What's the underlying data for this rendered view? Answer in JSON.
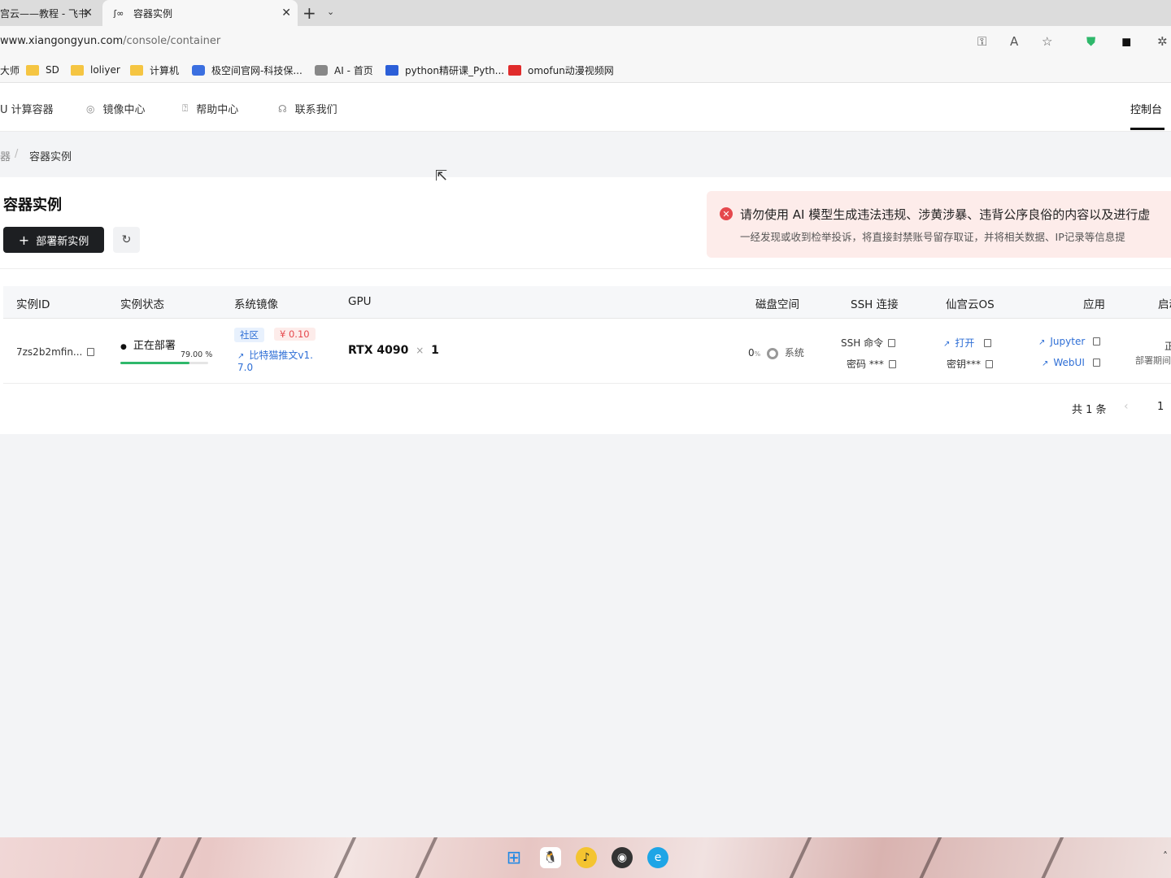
{
  "browser": {
    "tabs": [
      {
        "label": "宫云——教程 - 飞书",
        "active": false
      },
      {
        "label": "容器实例",
        "active": true
      }
    ],
    "url_host": "www.xiangongyun.com",
    "url_path": "/console/container",
    "bookmarks": [
      {
        "label": "大师",
        "icon": "folder-icon"
      },
      {
        "label": "SD",
        "icon": "folder-icon"
      },
      {
        "label": "loliyer",
        "icon": "folder-icon"
      },
      {
        "label": "计算机",
        "icon": "folder-icon"
      },
      {
        "label": "极空间官网-科技保...",
        "icon": "site-icon"
      },
      {
        "label": "AI - 首页",
        "icon": "site-icon"
      },
      {
        "label": "python精研课_Pyth...",
        "icon": "site-icon"
      },
      {
        "label": "omofun动漫视频网",
        "icon": "site-icon"
      }
    ]
  },
  "site_nav": {
    "items": [
      {
        "label": "U 计算容器"
      },
      {
        "label": "镜像中心"
      },
      {
        "label": "帮助中心"
      },
      {
        "label": "联系我们"
      }
    ],
    "console": "控制台"
  },
  "breadcrumb": {
    "parent": "器",
    "current": "容器实例"
  },
  "page": {
    "title": "容器实例",
    "deploy_button": "部署新实例",
    "alert_title": "请勿使用 AI 模型生成违法违规、涉黄涉暴、违背公序良俗的内容以及进行虚",
    "alert_desc": "一经发现或收到检举投诉，将直接封禁账号留存取证，并将相关数据、IP记录等信息提"
  },
  "table": {
    "headers": [
      "实例ID",
      "实例状态",
      "系统镜像",
      "GPU",
      "磁盘空间",
      "SSH 连接",
      "仙宫云OS",
      "应用",
      "启动"
    ],
    "row": {
      "instance_id": "7zs2b2mfin...",
      "status": "正在部署",
      "progress_label": "79.00 %",
      "progress": 79,
      "tag_community": "社区",
      "tag_price": "¥ 0.10",
      "image_name_1": "比特猫推文v1.",
      "image_name_2": "7.0",
      "gpu_model": "RTX 4090",
      "gpu_times": "×",
      "gpu_count": "1",
      "disk_percent": "0",
      "disk_unit": "%",
      "disk_label": "系统",
      "ssh_cmd": "SSH 命令",
      "ssh_pwd": "密码 ***",
      "os_open": "打开",
      "os_key": "密钥***",
      "app_jupyter": "Jupyter",
      "app_webui": "WebUI",
      "start_1": "正",
      "start_2": "部署期间"
    }
  },
  "pagination": {
    "total": "共 1 条",
    "current": "1"
  },
  "colors": {
    "accent": "#1d1f22",
    "link": "#2f6fd6",
    "alert_bg": "#fdecea",
    "progress": "#2fb86b",
    "price": "#e5484d"
  }
}
